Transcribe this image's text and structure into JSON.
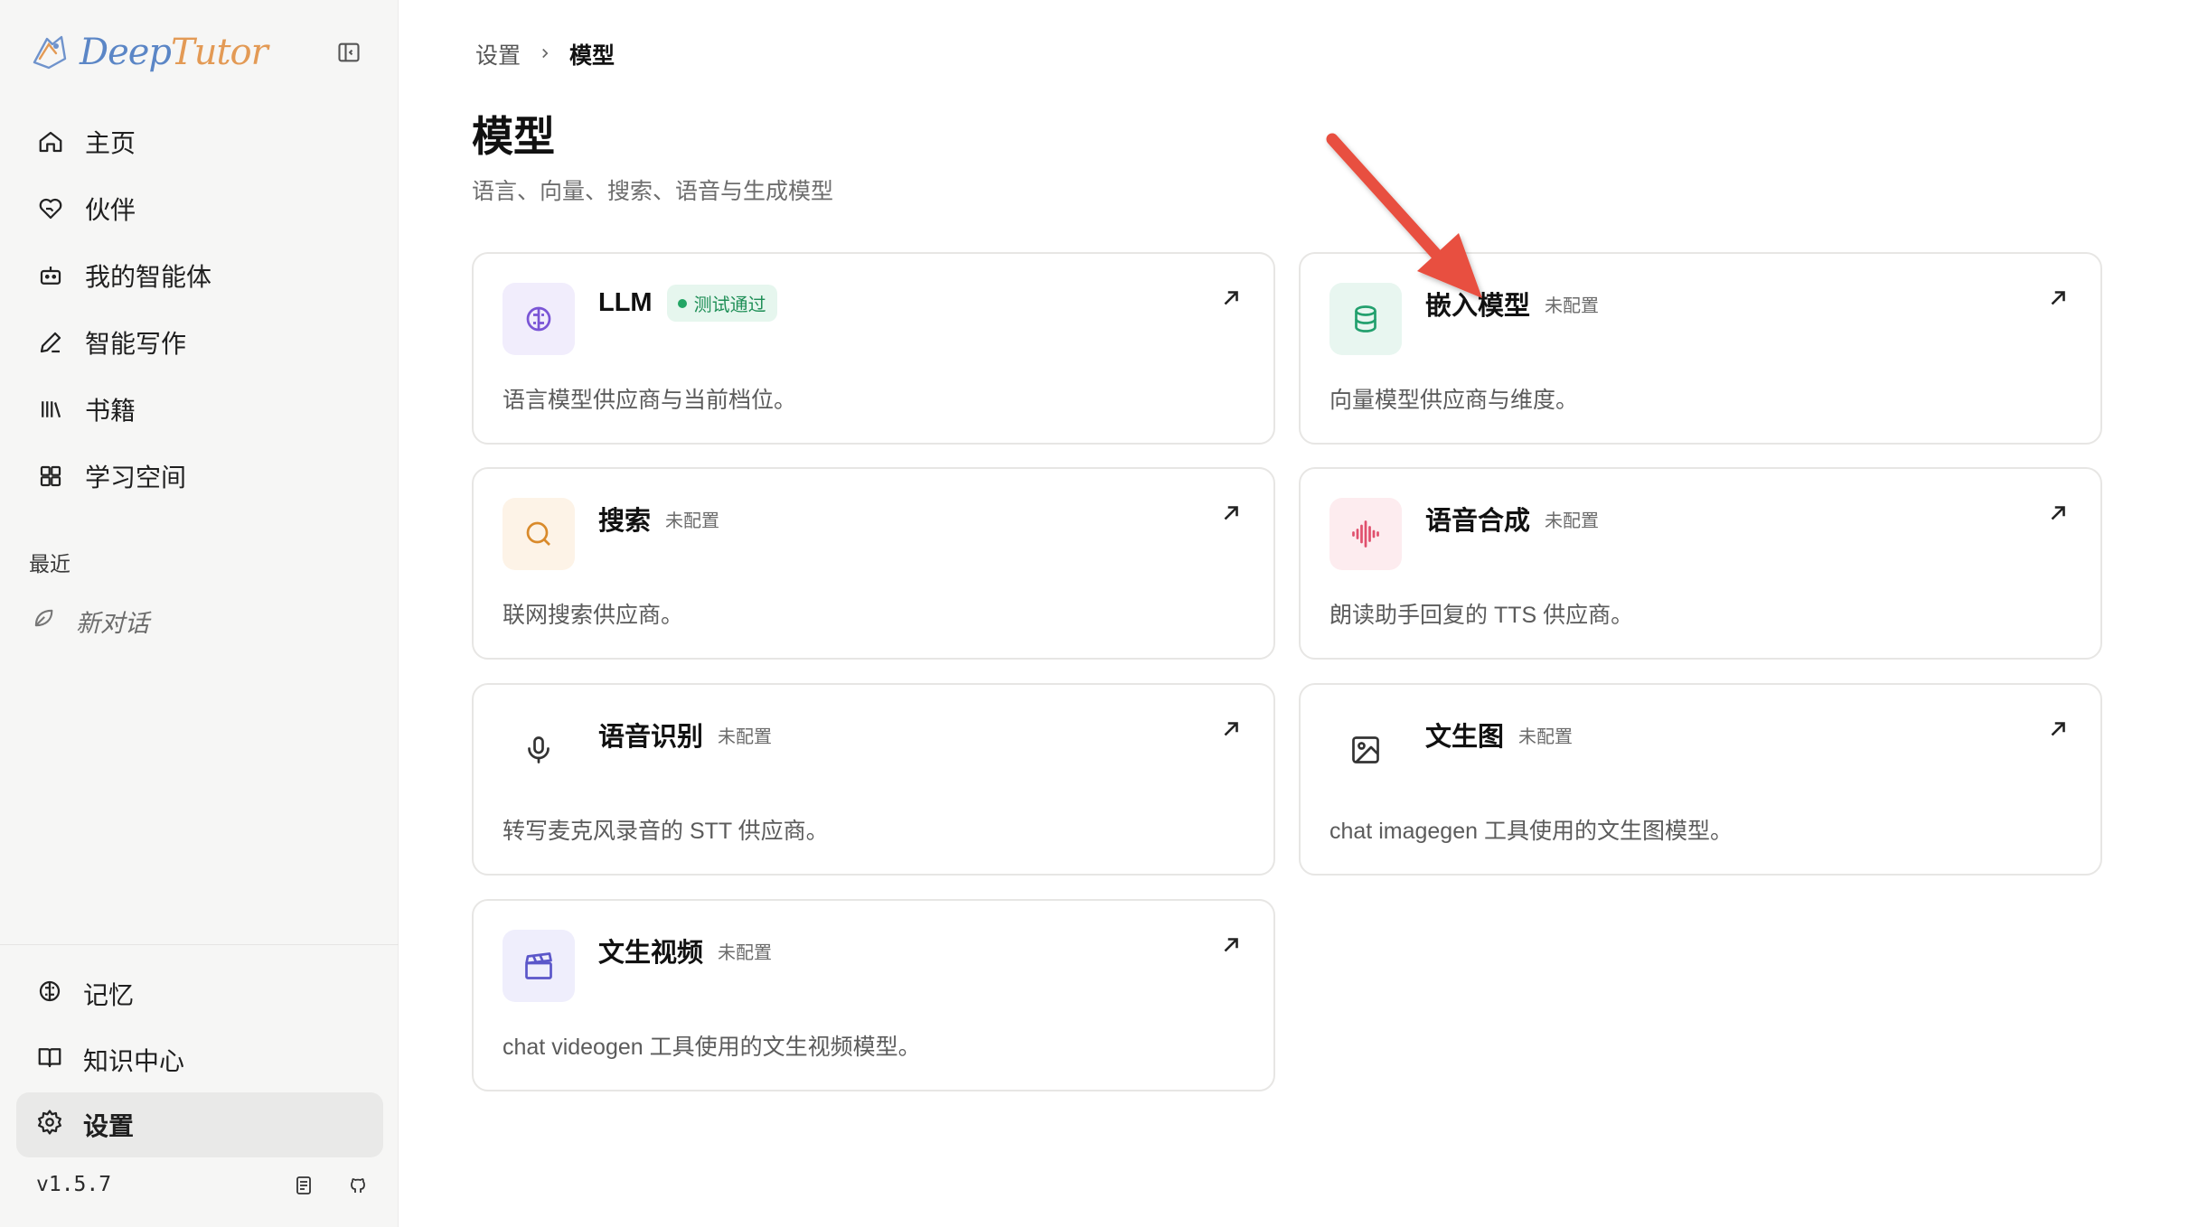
{
  "app": {
    "logo_text_a": "Deep",
    "logo_text_b": "Tutor",
    "version": "v1.5.7",
    "accent": "#5b86c6"
  },
  "sidebar": {
    "items": [
      {
        "label": "主页",
        "icon": "home-icon"
      },
      {
        "label": "伙伴",
        "icon": "heart-hand-icon"
      },
      {
        "label": "我的智能体",
        "icon": "bot-icon"
      },
      {
        "label": "智能写作",
        "icon": "pen-icon"
      },
      {
        "label": "书籍",
        "icon": "library-icon"
      },
      {
        "label": "学习空间",
        "icon": "grid-icon"
      }
    ],
    "recent_title": "最近",
    "recent_items": [
      {
        "label": "新对话",
        "icon": "leaf-icon"
      }
    ],
    "bottom_items": [
      {
        "label": "记忆",
        "icon": "brain-icon"
      },
      {
        "label": "知识中心",
        "icon": "book-open-icon"
      },
      {
        "label": "设置",
        "icon": "gear-icon",
        "active": true
      }
    ]
  },
  "breadcrumb": {
    "parent": "设置",
    "current": "模型"
  },
  "page": {
    "title": "模型",
    "subtitle": "语言、向量、搜索、语音与生成模型"
  },
  "cards": [
    {
      "title": "LLM",
      "status": "测试通过",
      "status_type": "ok",
      "desc": "语言模型供应商与当前档位。",
      "icon": "brain-icon",
      "icon_bg": "#f1edfc",
      "icon_color": "#7a55d6"
    },
    {
      "title": "嵌入模型",
      "status": "未配置",
      "status_type": "plain",
      "desc": "向量模型供应商与维度。",
      "icon": "database-icon",
      "icon_bg": "#e8f6f0",
      "icon_color": "#23a06e"
    },
    {
      "title": "搜索",
      "status": "未配置",
      "status_type": "plain",
      "desc": "联网搜索供应商。",
      "icon": "search-icon",
      "icon_bg": "#fdf3e7",
      "icon_color": "#d98a2b"
    },
    {
      "title": "语音合成",
      "status": "未配置",
      "status_type": "plain",
      "desc": "朗读助手回复的 TTS 供应商。",
      "icon": "audio-wave-icon",
      "icon_bg": "#fdecef",
      "icon_color": "#e0506d"
    },
    {
      "title": "语音识别",
      "status": "未配置",
      "status_type": "plain",
      "desc": "转写麦克风录音的 STT 供应商。",
      "icon": "microphone-icon",
      "icon_bg": "#ffffff",
      "icon_color": "#333333"
    },
    {
      "title": "文生图",
      "status": "未配置",
      "status_type": "plain",
      "desc": "chat imagegen 工具使用的文生图模型。",
      "icon": "image-icon",
      "icon_bg": "#ffffff",
      "icon_color": "#333333"
    },
    {
      "title": "文生视频",
      "status": "未配置",
      "status_type": "plain",
      "desc": "chat videogen 工具使用的文生视频模型。",
      "icon": "clapperboard-icon",
      "icon_bg": "#efeefc",
      "icon_color": "#5b56c9"
    }
  ],
  "annotation": {
    "arrow_color": "#e8503f"
  }
}
